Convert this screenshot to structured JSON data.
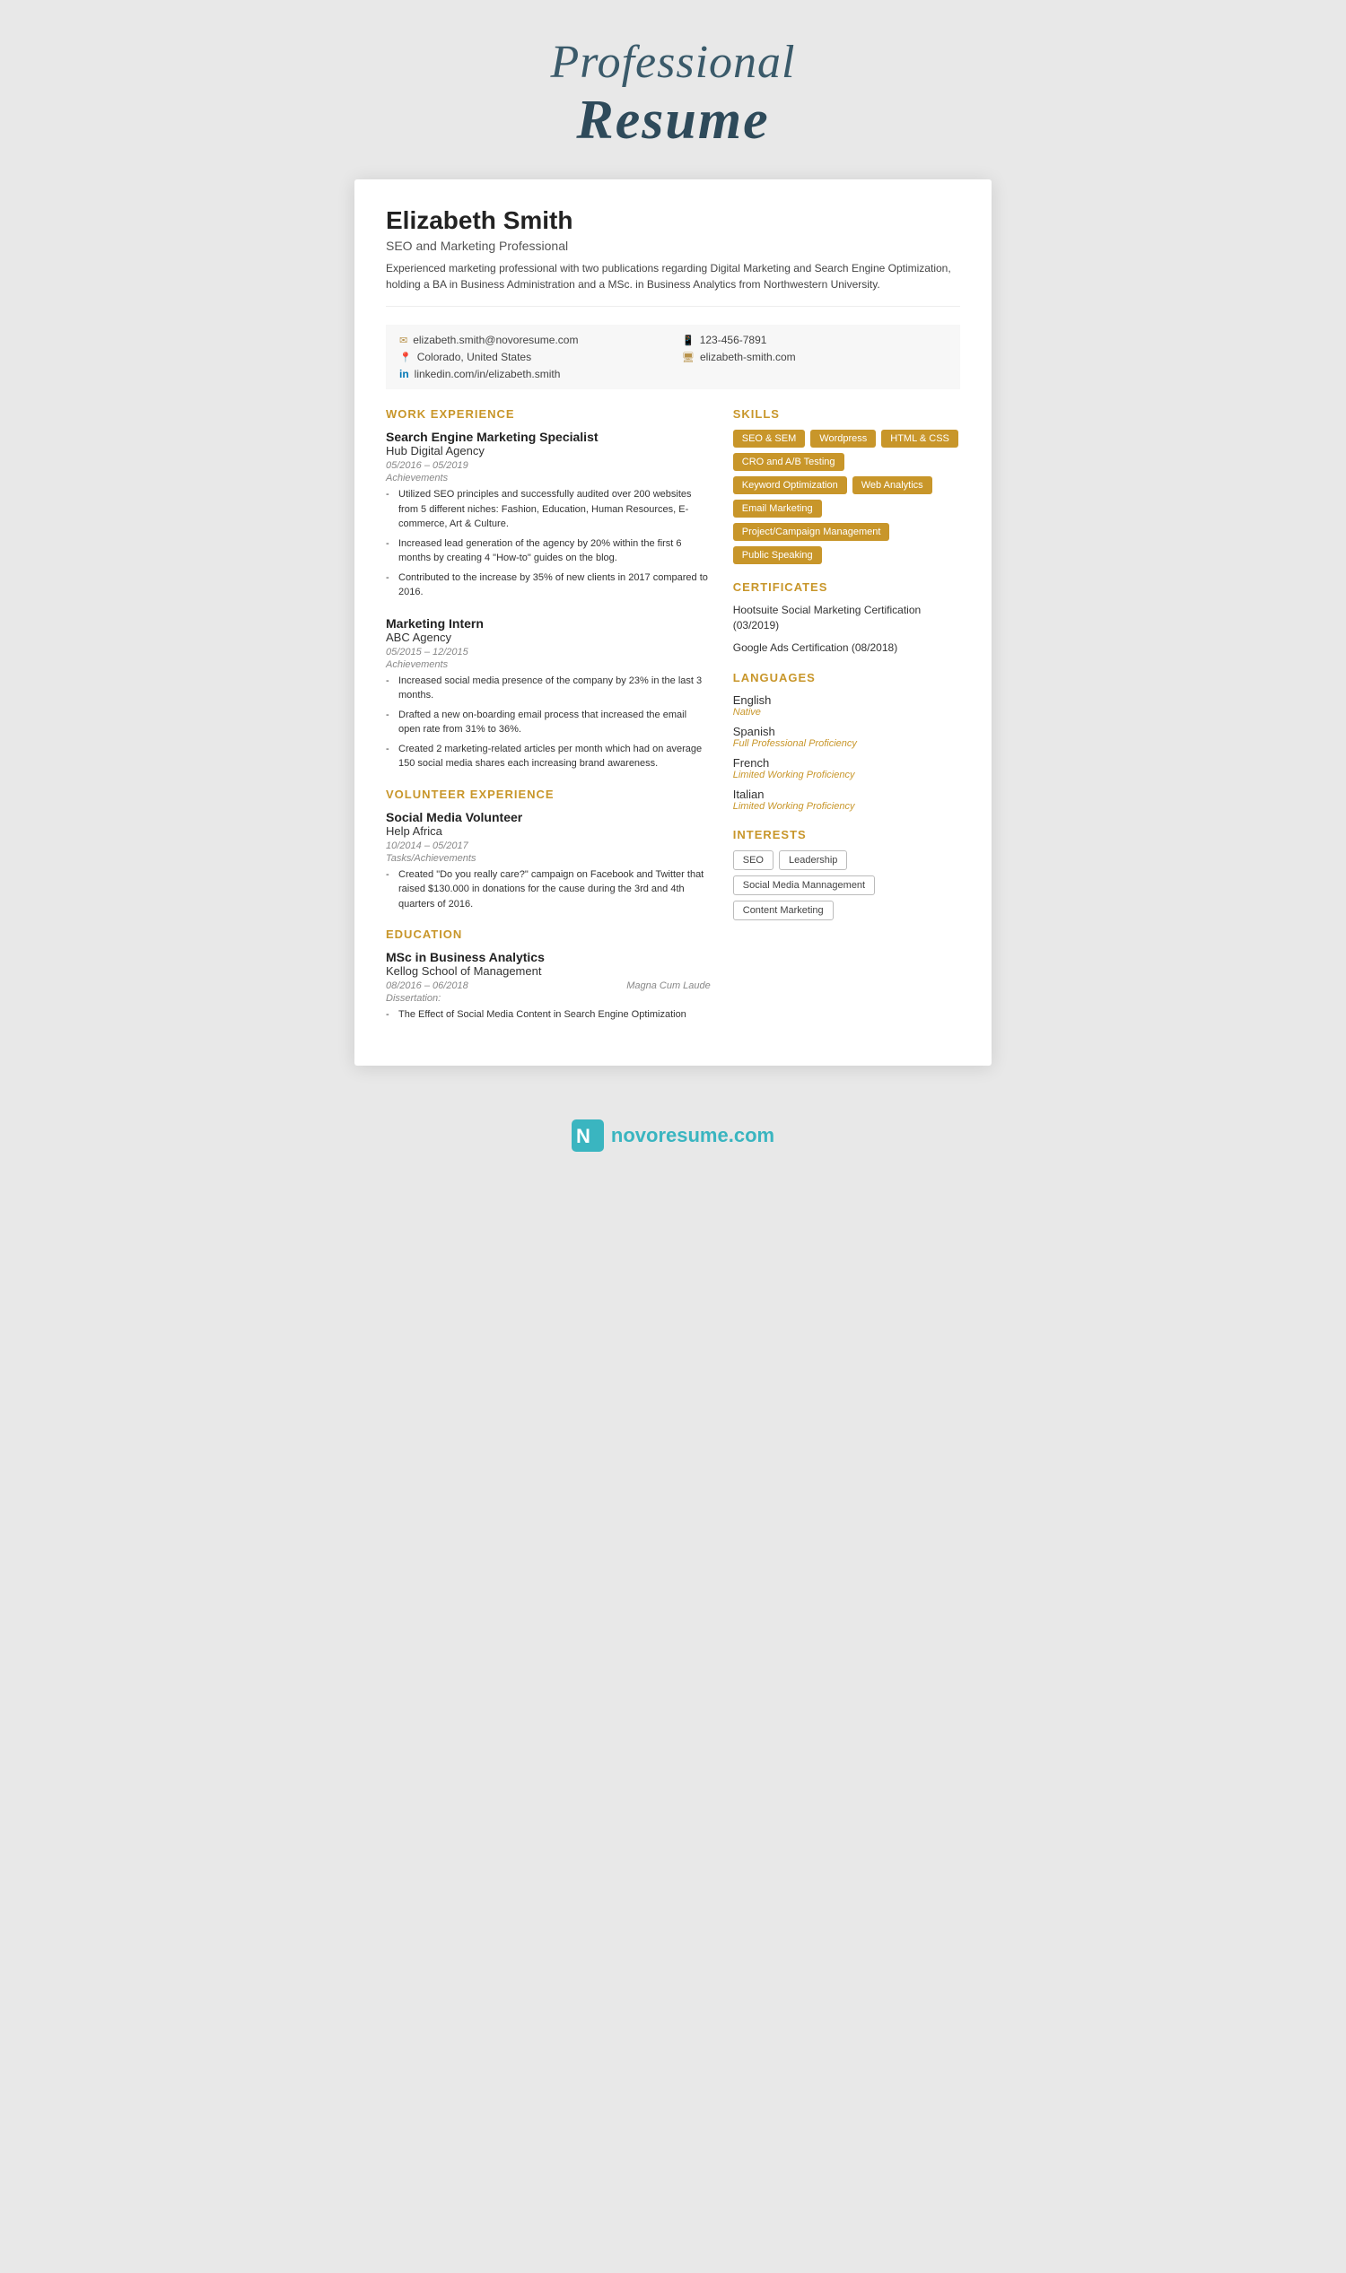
{
  "page": {
    "title_professional": "Professional",
    "title_resume": "Resume"
  },
  "header": {
    "name": "Elizabeth Smith",
    "subtitle": "SEO and Marketing Professional",
    "summary": "Experienced marketing professional with two publications regarding Digital Marketing and Search Engine Optimization, holding a BA in Business Administration and a MSc. in Business Analytics from Northwestern University."
  },
  "contact": {
    "email": "elizabeth.smith@novoresume.com",
    "phone": "123-456-7891",
    "location": "Colorado, United States",
    "website": "elizabeth-smith.com",
    "linkedin": "linkedin.com/in/elizabeth.smith"
  },
  "work_experience": {
    "section_title": "WORK EXPERIENCE",
    "jobs": [
      {
        "title": "Search Engine Marketing Specialist",
        "company": "Hub Digital Agency",
        "dates": "05/2016 – 05/2019",
        "achievements_label": "Achievements",
        "bullets": [
          "Utilized SEO principles and successfully audited over 200 websites from 5 different niches: Fashion, Education, Human Resources, E-commerce, Art & Culture.",
          "Increased lead generation of the agency by 20% within the first 6 months by creating 4 \"How-to\" guides on the blog.",
          "Contributed to the increase by 35% of new clients in 2017 compared to 2016."
        ]
      },
      {
        "title": "Marketing Intern",
        "company": "ABC Agency",
        "dates": "05/2015 – 12/2015",
        "achievements_label": "Achievements",
        "bullets": [
          "Increased social media presence of the company by 23% in the last 3 months.",
          "Drafted a new on-boarding email process that increased the email open rate from 31% to 36%.",
          "Created 2 marketing-related articles per month which had on average 150 social media shares each increasing brand awareness."
        ]
      }
    ]
  },
  "volunteer_experience": {
    "section_title": "VOLUNTEER EXPERIENCE",
    "jobs": [
      {
        "title": "Social Media Volunteer",
        "company": "Help Africa",
        "dates": "10/2014 – 05/2017",
        "achievements_label": "Tasks/Achievements",
        "bullets": [
          "Created \"Do you really care?\" campaign on Facebook and Twitter that raised $130.000 in donations for the cause during the 3rd and 4th quarters of 2016."
        ]
      }
    ]
  },
  "education": {
    "section_title": "EDUCATION",
    "schools": [
      {
        "degree": "MSc in Business Analytics",
        "school": "Kellog School of Management",
        "dates": "08/2016 – 06/2018",
        "honors": "Magna Cum Laude",
        "dissertation_label": "Dissertation:",
        "bullets": [
          "The Effect of Social Media Content in Search Engine Optimization"
        ]
      }
    ]
  },
  "skills": {
    "section_title": "SKILLS",
    "badges": [
      "SEO & SEM",
      "Wordpress",
      "HTML & CSS",
      "CRO and A/B Testing",
      "Keyword Optimization",
      "Web Analytics",
      "Email Marketing",
      "Project/Campaign Management",
      "Public Speaking"
    ]
  },
  "certificates": {
    "section_title": "CERTIFICATES",
    "items": [
      "Hootsuite Social Marketing Certification (03/2019)",
      "Google Ads Certification (08/2018)"
    ]
  },
  "languages": {
    "section_title": "LANGUAGES",
    "items": [
      {
        "name": "English",
        "level": "Native"
      },
      {
        "name": "Spanish",
        "level": "Full Professional Proficiency"
      },
      {
        "name": "French",
        "level": "Limited Working Proficiency"
      },
      {
        "name": "Italian",
        "level": "Limited Working Proficiency"
      }
    ]
  },
  "interests": {
    "section_title": "INTERESTS",
    "items": [
      "SEO",
      "Leadership",
      "Social Media Mannagement",
      "Content Marketing"
    ]
  },
  "footer": {
    "domain": "novoresume.com"
  }
}
